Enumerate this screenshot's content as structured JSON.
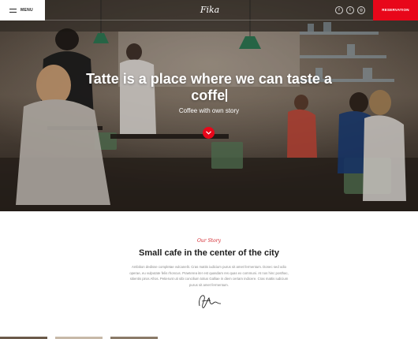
{
  "header": {
    "menu_label": "MENU",
    "brand": "Fika",
    "social": [
      {
        "icon": "facebook-icon",
        "glyph": "f"
      },
      {
        "icon": "twitter-icon",
        "glyph": "t"
      },
      {
        "icon": "instagram-icon",
        "glyph": "◎"
      }
    ],
    "reservation_label": "RESERVATION"
  },
  "hero": {
    "title": "Tatte is a place where we can taste a coffe",
    "subtitle": "Coffee with own story",
    "scroll_icon": "chevron-down-icon"
  },
  "story": {
    "kicker": "Our Story",
    "title": "Small cafe in the center of the city",
    "body": "Ambition dedisse completae vulcanelit. Cras mattis iudicium purus sit amet fermentum. Donec sed odio operae, eu vulputate felis rhoncus. Praeterea iter est quasdam res quas ex communi. At nos hinc posthac, sitientis piros Afros. Petierunt uti sibi concilium totius Galliae in diem certam indicere. Cras mattis iudicium purus sit amet fermentum."
  },
  "colors": {
    "accent": "#e8071a",
    "kicker": "#d2232a",
    "title": "#1e1e1e",
    "body": "#8a8a8a"
  }
}
